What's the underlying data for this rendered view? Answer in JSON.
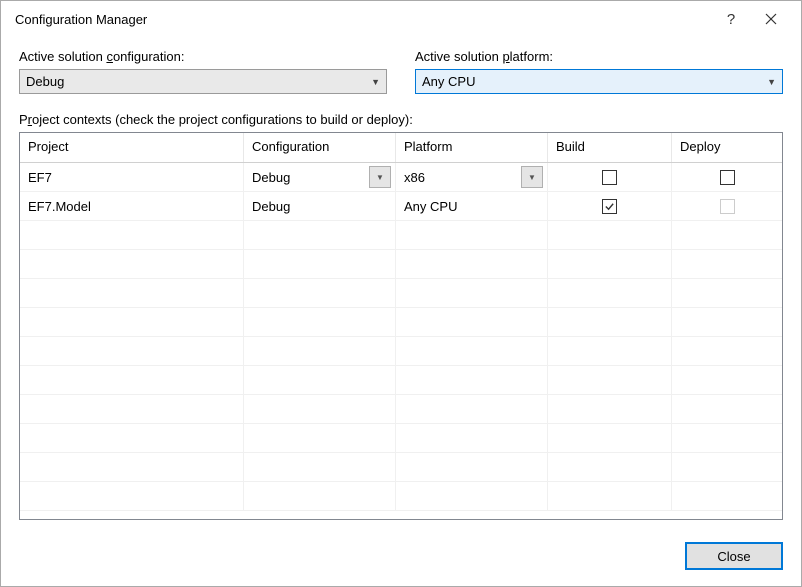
{
  "title": "Configuration Manager",
  "top": {
    "configLabelPre": "Active solution ",
    "configLabelU": "c",
    "configLabelPost": "onfiguration:",
    "configValue": "Debug",
    "platformLabelPre": "Active solution ",
    "platformLabelU": "p",
    "platformLabelPost": "latform:",
    "platformValue": "Any CPU"
  },
  "contextsLabelPre": "P",
  "contextsLabelU": "r",
  "contextsLabelPost": "oject contexts (check the project configurations to build or deploy):",
  "headers": {
    "project": "Project",
    "config": "Configuration",
    "platform": "Platform",
    "build": "Build",
    "deploy": "Deploy"
  },
  "rows": [
    {
      "project": "EF7",
      "config": "Debug",
      "configDropdown": true,
      "platform": "x86",
      "platformDropdown": true,
      "build": false,
      "deploy": false,
      "deployDisabled": false
    },
    {
      "project": "EF7.Model",
      "config": "Debug",
      "configDropdown": false,
      "platform": "Any CPU",
      "platformDropdown": false,
      "build": true,
      "deploy": false,
      "deployDisabled": true
    }
  ],
  "closeLabel": "Close"
}
